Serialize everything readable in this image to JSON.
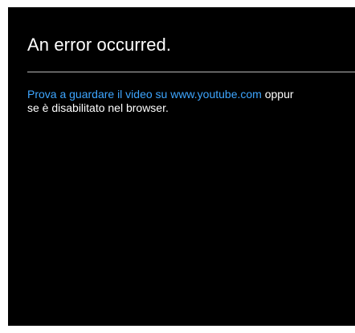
{
  "error": {
    "title": "An error occurred.",
    "link_text": "Prova a guardare il video su www.youtube.com",
    "text_after_link": " oppur",
    "line2": "se è disabilitato nel browser."
  },
  "colors": {
    "background": "#000000",
    "text": "#ffffff",
    "link": "#3ea6ff"
  }
}
